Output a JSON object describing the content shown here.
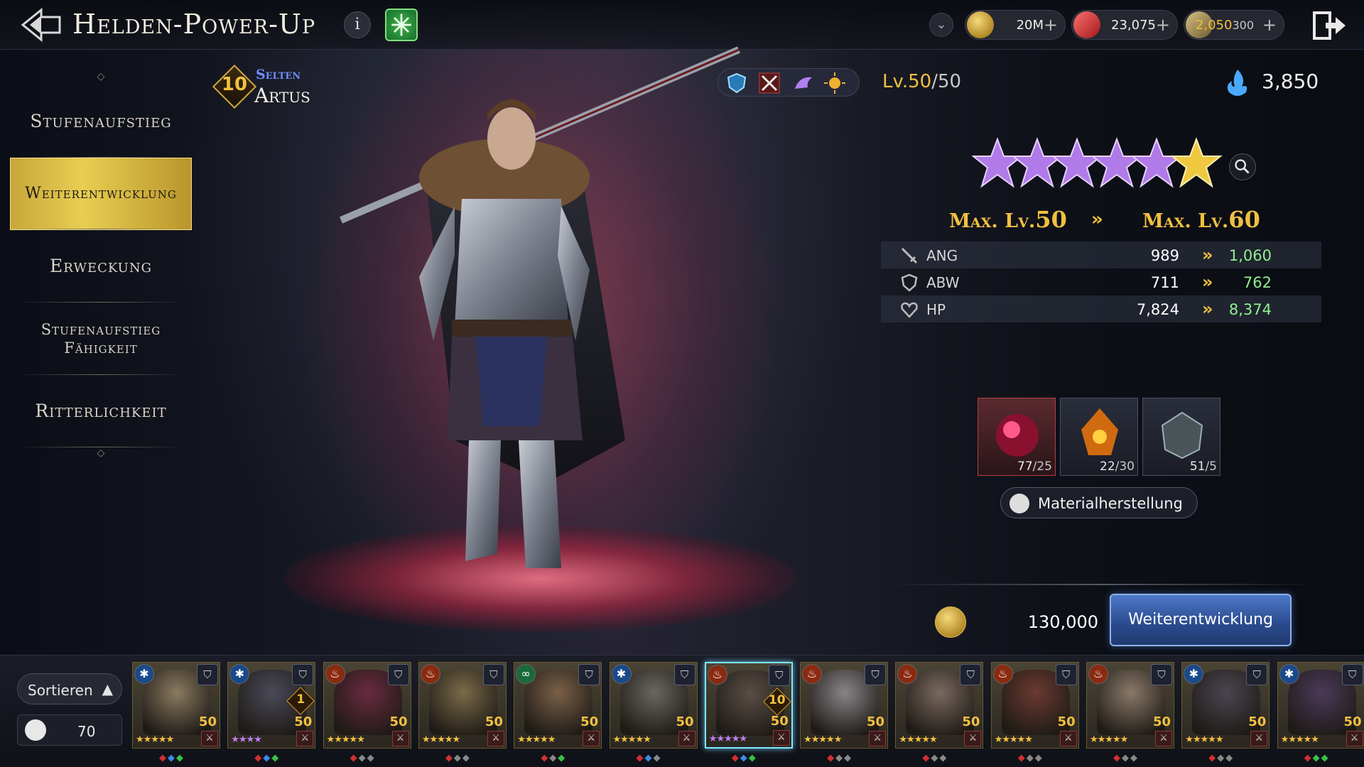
{
  "header": {
    "title": "Helden-Power-Up",
    "info_label": "i",
    "resources": [
      {
        "name": "gold",
        "value": "20M",
        "icon": "gold-coin-icon"
      },
      {
        "name": "gems",
        "value": "23,075",
        "icon": "red-gem-icon"
      },
      {
        "name": "stamina",
        "value": "2,050",
        "max": "300",
        "icon": "quill-icon"
      }
    ],
    "plus_label": "+"
  },
  "menu": {
    "items": [
      {
        "label": "Stufenaufstieg",
        "active": false
      },
      {
        "label": "Weiterentwicklung",
        "active": true
      },
      {
        "label": "Erweckung",
        "active": false
      },
      {
        "label": "Stufenaufstieg Fähigkeit",
        "active": false
      },
      {
        "label": "Ritterlichkeit",
        "active": false
      }
    ]
  },
  "hero": {
    "star_level": "10",
    "rarity": "Selten",
    "name": "Artus",
    "level_prefix": "Lv.",
    "level": "50",
    "level_max": "/50",
    "power": "3,850",
    "stars": {
      "total": 6,
      "purple": 5,
      "gold": 1
    }
  },
  "evolution": {
    "max_prefix": "Max. Lv.",
    "from_level": "50",
    "to_level": "60",
    "arrow": "»",
    "stats": [
      {
        "label": "ANG",
        "icon": "sword-icon",
        "current": "989",
        "new": "1,060"
      },
      {
        "label": "ABW",
        "icon": "shield-icon",
        "current": "711",
        "new": "762"
      },
      {
        "label": "HP",
        "icon": "heart-icon",
        "current": "7,824",
        "new": "8,374"
      }
    ],
    "materials": [
      {
        "name": "crimson-orb",
        "have": "77",
        "need": "/25"
      },
      {
        "name": "sun-crystal",
        "have": "22",
        "need": "/30"
      },
      {
        "name": "frost-stone",
        "have": "51",
        "need": "/5"
      }
    ],
    "craft_label": "Materialherstellung",
    "cost": "130,000",
    "evolve_label": "Weiterentwicklung"
  },
  "roster": {
    "sort_label": "Sortieren",
    "count": "70",
    "heroes": [
      {
        "element": "frost",
        "level": "50",
        "stars": "★★★★★",
        "purple": false,
        "dots": "●●●",
        "colors": [
          "#d03030",
          "#3a8ae8",
          "#38c048"
        ]
      },
      {
        "element": "frost",
        "level": "50",
        "stars": "★★★★",
        "purple": true,
        "dots": "●●●",
        "colors": [
          "#d03030",
          "#3a8ae8",
          "#38c048"
        ],
        "badge": "1"
      },
      {
        "element": "fire",
        "level": "50",
        "stars": "★★★★★",
        "purple": false,
        "dots": "●●●",
        "colors": [
          "#d03030",
          "#888888",
          "#888888"
        ]
      },
      {
        "element": "fire",
        "level": "50",
        "stars": "★★★★★",
        "purple": false,
        "dots": "●●●",
        "colors": [
          "#d03030",
          "#888888",
          "#888888"
        ]
      },
      {
        "element": "nature",
        "level": "50",
        "stars": "★★★★★",
        "purple": false,
        "dots": "●●●",
        "colors": [
          "#d03030",
          "#888888",
          "#38c048"
        ]
      },
      {
        "element": "frost",
        "level": "50",
        "stars": "★★★★★",
        "purple": false,
        "dots": "●●●",
        "colors": [
          "#d03030",
          "#3a8ae8",
          "#888888"
        ]
      },
      {
        "element": "fire",
        "level": "50",
        "stars": "★★★★★",
        "purple": true,
        "dots": "●●●",
        "colors": [
          "#d03030",
          "#3a8ae8",
          "#38c048"
        ],
        "badge": "10",
        "selected": true
      },
      {
        "element": "fire",
        "level": "50",
        "stars": "★★★★★",
        "purple": false,
        "dots": "●●●",
        "colors": [
          "#d03030",
          "#888888",
          "#888888"
        ]
      },
      {
        "element": "fire",
        "level": "50",
        "stars": "★★★★★",
        "purple": false,
        "dots": "●●●",
        "colors": [
          "#d03030",
          "#888888",
          "#888888"
        ]
      },
      {
        "element": "fire",
        "level": "50",
        "stars": "★★★★★",
        "purple": false,
        "dots": "●●●",
        "colors": [
          "#d03030",
          "#888888",
          "#888888"
        ]
      },
      {
        "element": "fire",
        "level": "50",
        "stars": "★★★★★",
        "purple": false,
        "dots": "●●●",
        "colors": [
          "#d03030",
          "#888888",
          "#888888"
        ]
      },
      {
        "element": "frost",
        "level": "50",
        "stars": "★★★★★",
        "purple": false,
        "dots": "●●●",
        "colors": [
          "#d03030",
          "#888888",
          "#888888"
        ]
      },
      {
        "element": "frost",
        "level": "50",
        "stars": "★★★★★",
        "purple": false,
        "dots": "●●●",
        "colors": [
          "#d03030",
          "#38c048",
          "#38c048"
        ]
      }
    ]
  },
  "colors": {
    "gold": "#f0c040",
    "green_stat": "#8ff08f",
    "rarity_blue": "#6d8dff",
    "button_blue": "#2a4a8c"
  }
}
